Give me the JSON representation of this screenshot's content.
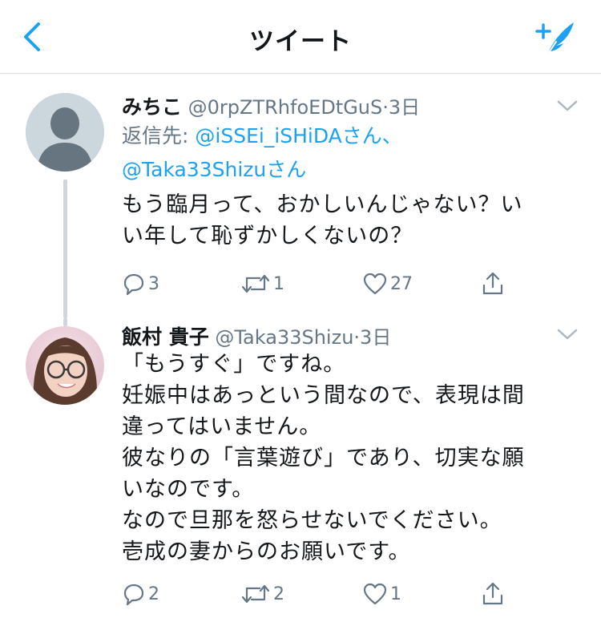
{
  "header": {
    "title": "ツイート",
    "back_icon": "chevron-left-icon",
    "compose_icon": "compose-tweet-icon",
    "accent": "#1da1f2"
  },
  "tweets": [
    {
      "name": "みちこ",
      "handle": "@0rpZTRhfoEDtGuS",
      "time": "3日",
      "reply_to": {
        "prefix": "返信先: ",
        "mention1": "@iSSEi_iSHiDAさん、",
        "mention2": "@Taka33Shizuさん"
      },
      "lines": [
        "もう臨月って、おかしいんじゃない？い",
        "い年して恥ずかしくないの？"
      ],
      "replies": "3",
      "retweets": "1",
      "likes": "27"
    },
    {
      "name": "飯村 貴子",
      "handle": "@Taka33Shizu",
      "time": "3日",
      "lines": [
        "「もうすぐ」ですね。",
        "妊娠中はあっという間なので、表現は間",
        "違ってはいません。",
        "彼なりの「言葉遊び」であり、切実な願",
        "いなのです。",
        "なので旦那を怒らせないでください。",
        "壱成の妻からのお願いです。"
      ],
      "replies": "2",
      "retweets": "2",
      "likes": "1"
    }
  ]
}
